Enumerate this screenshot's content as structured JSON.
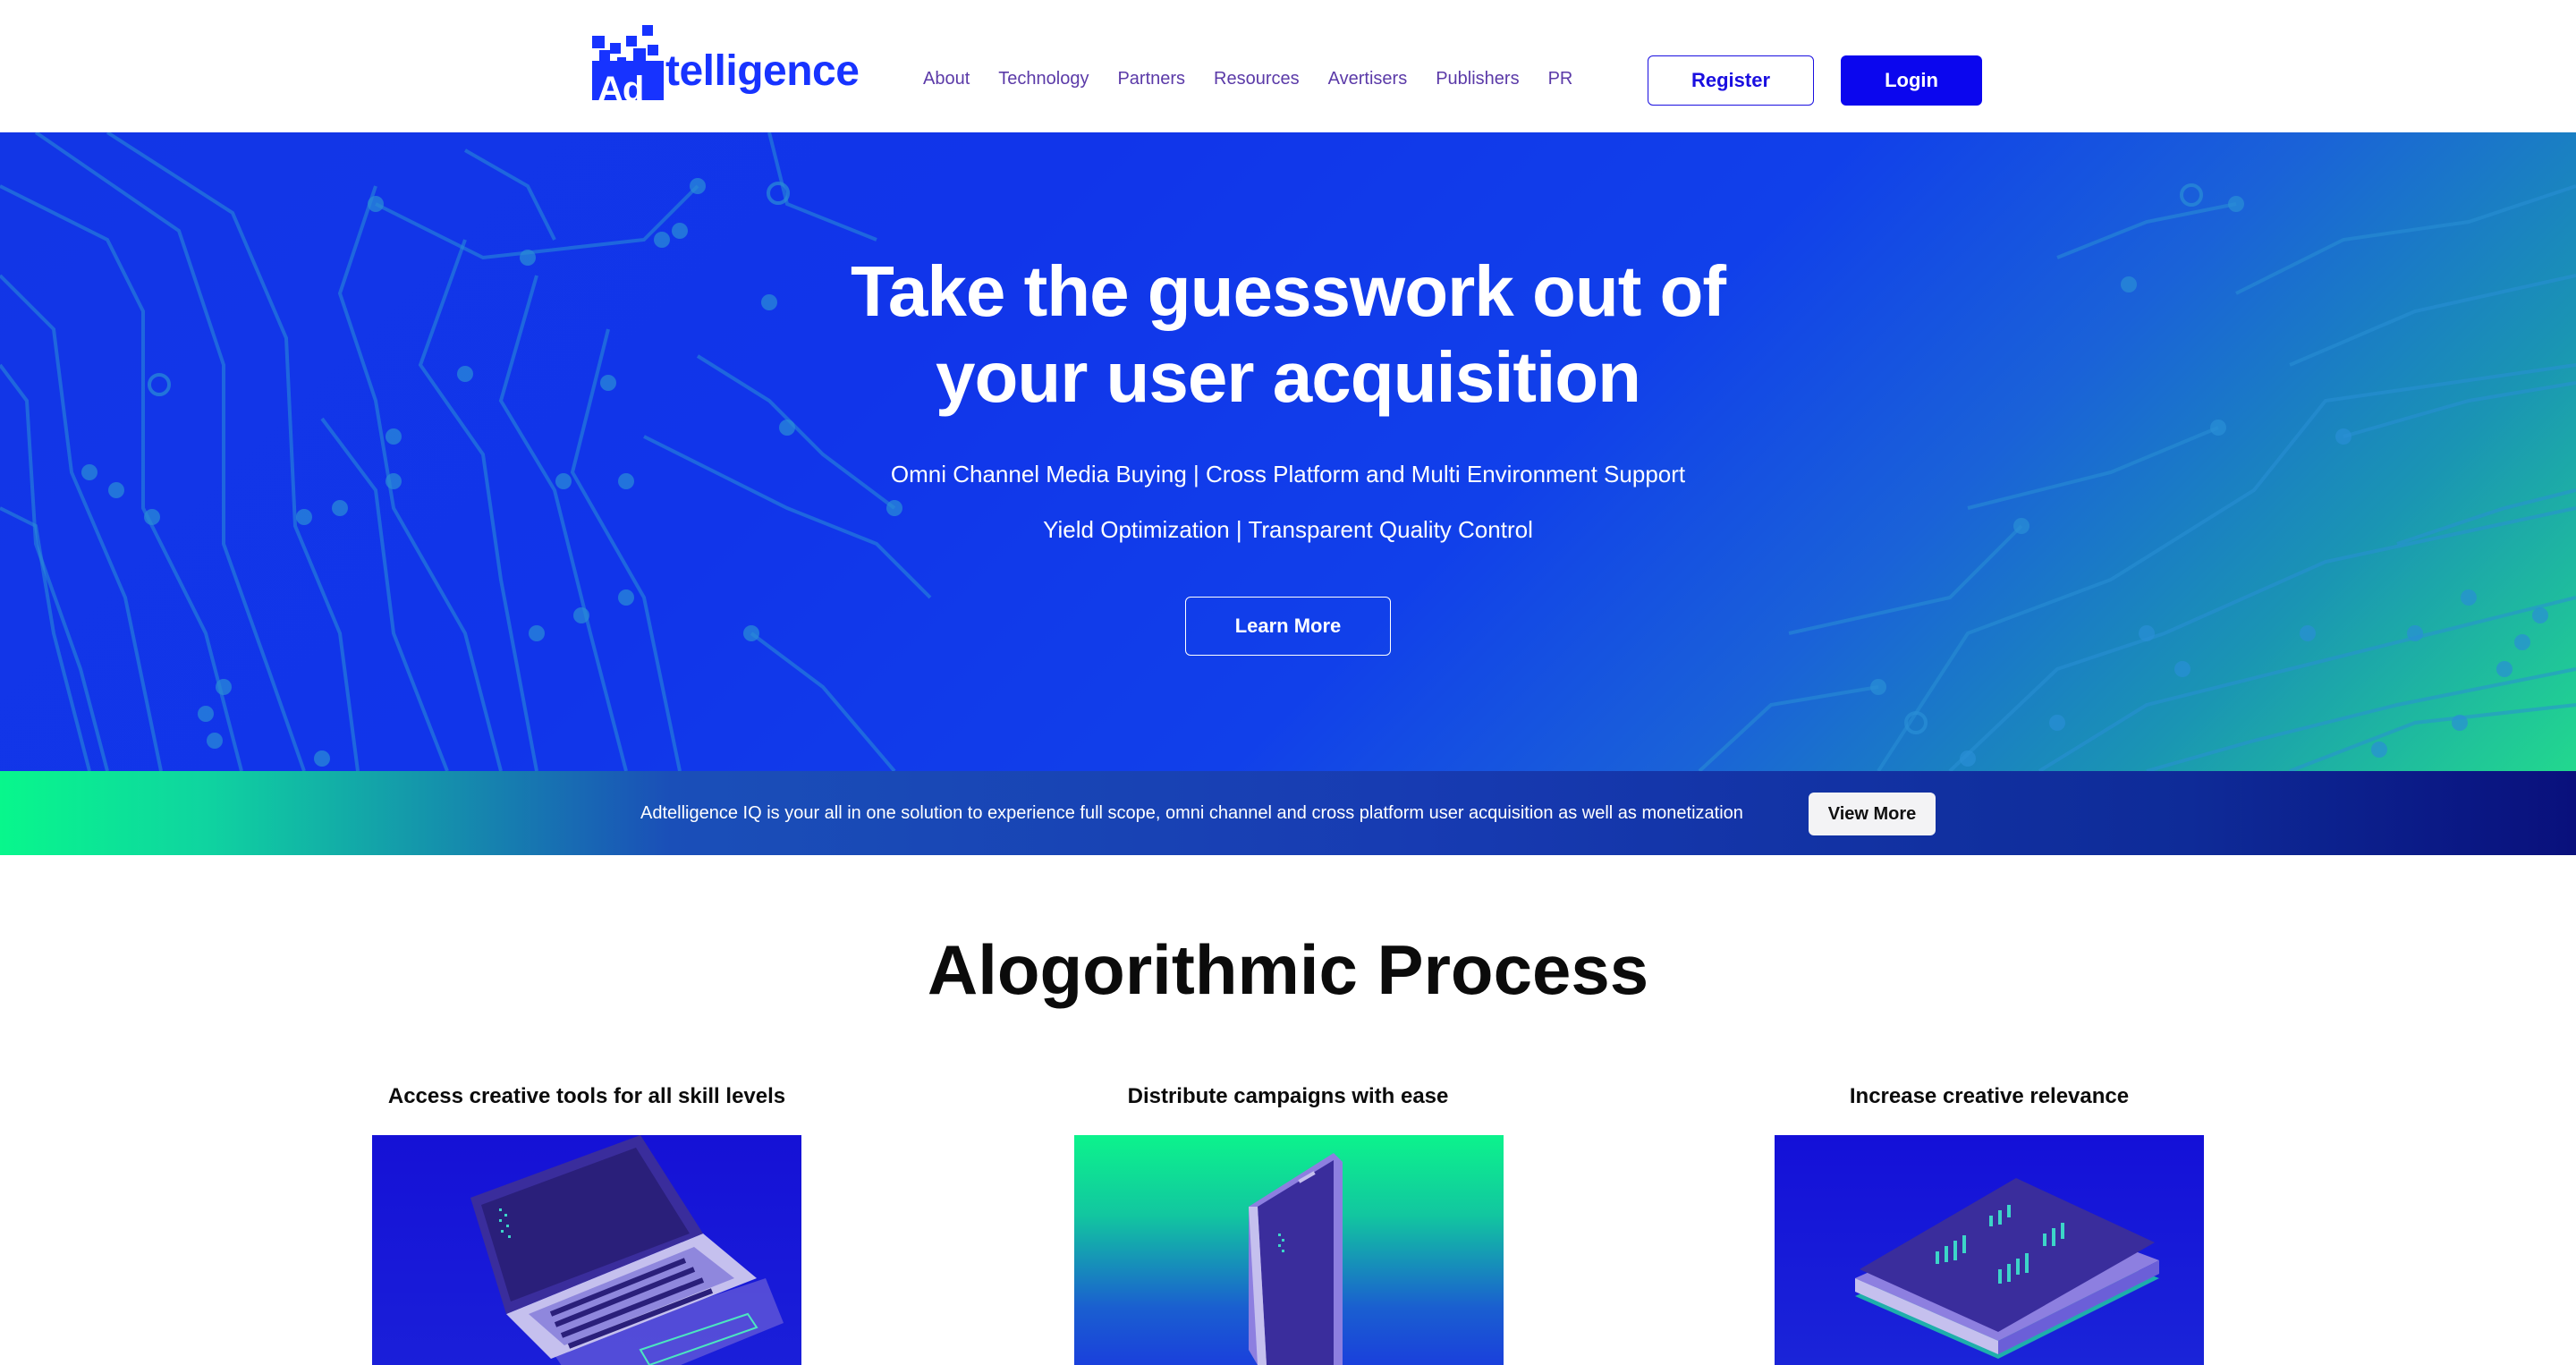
{
  "header": {
    "logo_text": "telligence",
    "logo_badge": "Ad",
    "nav": [
      {
        "label": "About"
      },
      {
        "label": "Technology"
      },
      {
        "label": "Partners"
      },
      {
        "label": "Resources"
      },
      {
        "label": "Avertisers"
      },
      {
        "label": "Publishers"
      },
      {
        "label": "PR"
      }
    ],
    "register_label": "Register",
    "login_label": "Login"
  },
  "hero": {
    "title_line1": "Take the guesswork out of",
    "title_line2": "your user acquisition",
    "subtitle1": "Omni Channel Media Buying | Cross Platform and Multi Environment Support",
    "subtitle2": "Yield Optimization | Transparent Quality Control",
    "cta_label": "Learn More"
  },
  "banner": {
    "text": "Adtelligence IQ is your all in one solution to experience full scope, omni channel and cross platform user acquisition as well as monetization",
    "button_label": "View More"
  },
  "process": {
    "title": "Alogorithmic Process",
    "cards": [
      {
        "title": "Access creative tools for all skill levels",
        "icon": "laptop-illustration"
      },
      {
        "title": "Distribute campaigns with ease",
        "icon": "phone-illustration"
      },
      {
        "title": "Increase creative relevance",
        "icon": "chip-illustration"
      }
    ]
  },
  "colors": {
    "brand_blue": "#0b06ee",
    "nav_text": "#5b3aa8",
    "accent_green": "#08f78c"
  }
}
